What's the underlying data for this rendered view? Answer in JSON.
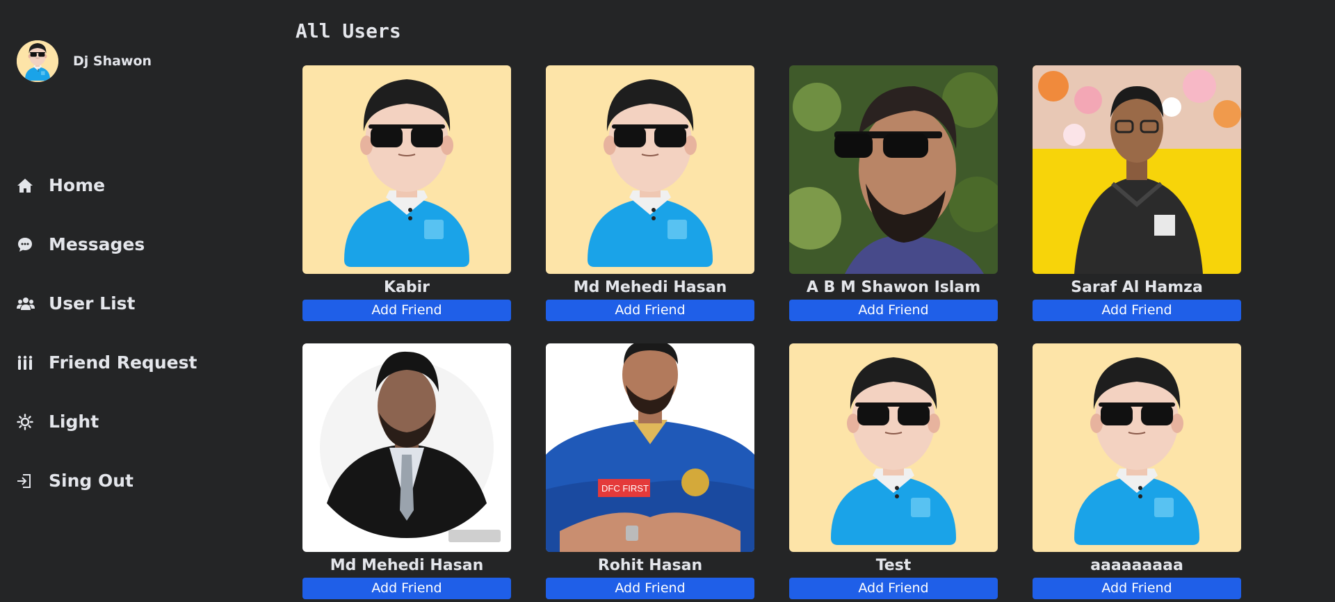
{
  "user": {
    "name": "Dj Shawon"
  },
  "sidebar": {
    "items": [
      {
        "label": "Home",
        "icon": "home-icon"
      },
      {
        "label": "Messages",
        "icon": "message-icon"
      },
      {
        "label": "User List",
        "icon": "users-icon"
      },
      {
        "label": "Friend Request",
        "icon": "people-group-icon"
      },
      {
        "label": "Light",
        "icon": "sun-icon"
      },
      {
        "label": "Sing Out",
        "icon": "sign-out-icon"
      }
    ]
  },
  "main": {
    "title": "All Users",
    "button_label": "Add Friend",
    "users": [
      {
        "name": "Kabir",
        "photo": "cartoon-avatar"
      },
      {
        "name": "Md Mehedi Hasan",
        "photo": "cartoon-avatar"
      },
      {
        "name": "A B M Shawon Islam",
        "photo": "bearded-man-photo"
      },
      {
        "name": "Saraf Al Hamza",
        "photo": "young-man-flowers-photo"
      },
      {
        "name": "Md Mehedi Hasan",
        "photo": "man-in-suit-photo"
      },
      {
        "name": "Rohit Hasan",
        "photo": "cricketer-jersey-photo"
      },
      {
        "name": "Test",
        "photo": "cartoon-avatar"
      },
      {
        "name": "aaaaaaaaa",
        "photo": "cartoon-avatar"
      }
    ]
  },
  "colors": {
    "background": "#242526",
    "accent": "#1f5fe8",
    "text": "#e4e6eb",
    "avatar_bg": "#fde4a8"
  }
}
